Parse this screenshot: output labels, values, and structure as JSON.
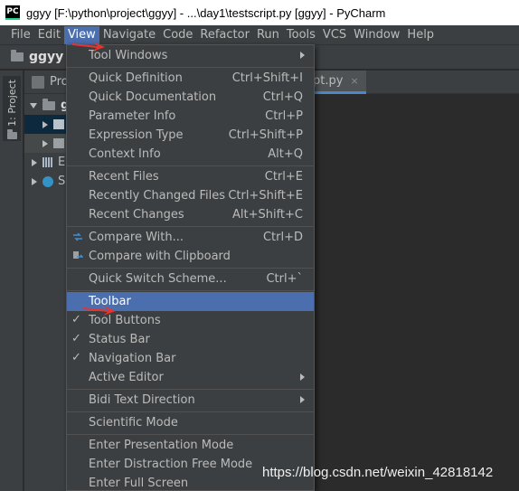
{
  "window": {
    "app_icon_text": "PC",
    "title": "ggyy [F:\\python\\project\\ggyy] - ...\\day1\\testscript.py [ggyy] - PyCharm"
  },
  "menubar": {
    "items": [
      {
        "label": "File"
      },
      {
        "label": "Edit"
      },
      {
        "label": "View"
      },
      {
        "label": "Navigate"
      },
      {
        "label": "Code"
      },
      {
        "label": "Refactor"
      },
      {
        "label": "Run"
      },
      {
        "label": "Tools"
      },
      {
        "label": "VCS"
      },
      {
        "label": "Window"
      },
      {
        "label": "Help"
      }
    ],
    "active": "View"
  },
  "navbar": {
    "project": "ggyy"
  },
  "toolstrip": {
    "project_tab": "1: Project"
  },
  "project_panel": {
    "header": "Pro",
    "rows": [
      {
        "label": "gg"
      },
      {
        "label": ""
      },
      {
        "label": ""
      },
      {
        "label": "E"
      },
      {
        "label": "S"
      }
    ]
  },
  "editor": {
    "tab_label": "pt.py",
    "tab_close": "×"
  },
  "view_menu": {
    "tool_windows": "Tool Windows",
    "quick_definition": {
      "label": "Quick Definition",
      "shortcut": "Ctrl+Shift+I"
    },
    "quick_documentation": {
      "label": "Quick Documentation",
      "shortcut": "Ctrl+Q"
    },
    "parameter_info": {
      "label": "Parameter Info",
      "shortcut": "Ctrl+P"
    },
    "expression_type": {
      "label": "Expression Type",
      "shortcut": "Ctrl+Shift+P"
    },
    "context_info": {
      "label": "Context Info",
      "shortcut": "Alt+Q"
    },
    "recent_files": {
      "label": "Recent Files",
      "shortcut": "Ctrl+E"
    },
    "recently_changed_files": {
      "label": "Recently Changed Files",
      "shortcut": "Ctrl+Shift+E"
    },
    "recent_changes": {
      "label": "Recent Changes",
      "shortcut": "Alt+Shift+C"
    },
    "compare_with": {
      "label": "Compare With...",
      "shortcut": "Ctrl+D"
    },
    "compare_with_clipboard": {
      "label": "Compare with Clipboard",
      "shortcut": ""
    },
    "quick_switch_scheme": {
      "label": "Quick Switch Scheme...",
      "shortcut": "Ctrl+`"
    },
    "toolbar": {
      "label": "Toolbar",
      "checked": false
    },
    "tool_buttons": {
      "label": "Tool Buttons",
      "checked": true
    },
    "status_bar": {
      "label": "Status Bar",
      "checked": true
    },
    "navigation_bar": {
      "label": "Navigation Bar",
      "checked": true
    },
    "active_editor": "Active Editor",
    "bidi_text_direction": "Bidi Text Direction",
    "scientific_mode": "Scientific Mode",
    "enter_presentation_mode": "Enter Presentation Mode",
    "enter_distraction_free_mode": "Enter Distraction Free Mode",
    "enter_full_screen": "Enter Full Screen",
    "check_mark": "✓"
  },
  "watermark": "https://blog.csdn.net/weixin_42818142",
  "colors": {
    "menu_bg": "#3c3f41",
    "highlight": "#4b6eaf",
    "annotation_red": "#e8332a"
  }
}
